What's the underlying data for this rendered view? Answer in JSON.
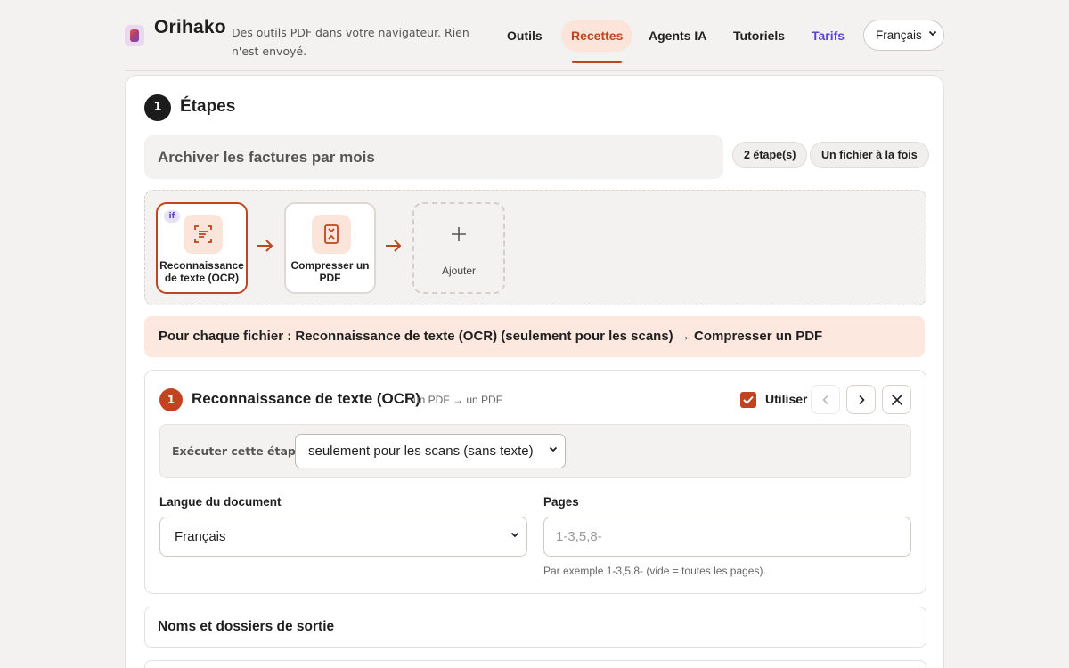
{
  "header": {
    "brand": "Orihako",
    "tagline": "Des outils PDF dans votre navigateur. Rien n'est envoyé.",
    "nav": [
      {
        "label": "Outils"
      },
      {
        "label": "Recettes"
      },
      {
        "label": "Agents IA"
      },
      {
        "label": "Tutoriels"
      },
      {
        "label": "Tarifs"
      }
    ],
    "active_nav": "Recettes",
    "language": "Français"
  },
  "steps_section": {
    "number": "1",
    "title": "Étapes",
    "recipe_name": "Archiver les factures par mois",
    "pill_steps": "2 étape(s)",
    "pill_mode": "Un fichier à la fois",
    "flow": [
      {
        "label": "Reconnaissance de texte (OCR)",
        "conditional_tag": "if",
        "selected": true,
        "icon": "ocr-icon"
      },
      {
        "label": "Compresser un PDF",
        "selected": false,
        "icon": "compress-icon"
      }
    ],
    "add_label": "Ajouter",
    "summary": "Pour chaque fichier : Reconnaissance de texte (OCR) (seulement pour les scans) → Compresser un PDF"
  },
  "step_detail": {
    "number": "1",
    "title": "Reconnaissance de texte (OCR)",
    "io_hint": "un PDF → un PDF",
    "use_label": "Utiliser",
    "use_checked": true,
    "condition_label": "Exécuter cette étape",
    "condition_value": "seulement pour les scans (sans texte)",
    "language_label": "Langue du document",
    "language_value": "Français",
    "pages_label": "Pages",
    "pages_placeholder": "1-3,5,8-",
    "pages_hint": "Par exemple 1-3,5,8- (vide = toutes les pages)."
  },
  "output_section": {
    "title": "Noms et dossiers de sortie"
  },
  "colors": {
    "accent": "#c0441f",
    "accent_soft": "#fbe4da",
    "pricing": "#5b45c9",
    "background": "#f4f2f0"
  }
}
